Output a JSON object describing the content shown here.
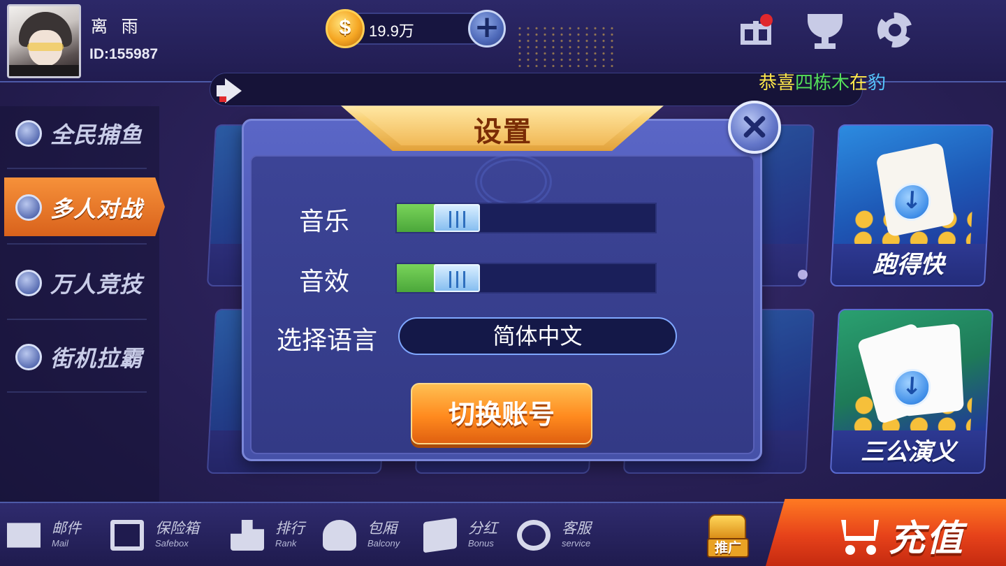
{
  "user": {
    "name": "离 雨",
    "id": "ID:155987"
  },
  "currency": {
    "amount": "19.9万",
    "symbol": "$"
  },
  "top_icons": [
    "gift-icon",
    "trophy-icon",
    "gear-icon"
  ],
  "marquee": {
    "part1": "恭喜",
    "part2": "四栋木",
    "part3": "在",
    "part4": "豹"
  },
  "sidebar": {
    "items": [
      {
        "label": "全民捕鱼",
        "active": false
      },
      {
        "label": "多人对战",
        "active": true
      },
      {
        "label": "万人竞技",
        "active": false
      },
      {
        "label": "街机拉霸",
        "active": false
      }
    ]
  },
  "games": {
    "right_top": "跑得快",
    "right_bottom": "三公演义"
  },
  "settings": {
    "title": "设置",
    "music_label": "音乐",
    "music_level": 0.16,
    "sfx_label": "音效",
    "sfx_level": 0.16,
    "language_label": "选择语言",
    "language_value": "简体中文",
    "switch_account": "切换账号"
  },
  "bottom": {
    "items": [
      {
        "cn": "邮件",
        "en": "Mail",
        "icon": "mail-icon"
      },
      {
        "cn": "保险箱",
        "en": "Safebox",
        "icon": "safebox-icon"
      },
      {
        "cn": "排行",
        "en": "Rank",
        "icon": "rank-icon"
      },
      {
        "cn": "包厢",
        "en": "Balcony",
        "icon": "balcony-icon"
      },
      {
        "cn": "分红",
        "en": "Bonus",
        "icon": "wallet-icon"
      },
      {
        "cn": "客服",
        "en": "service",
        "icon": "headset-icon"
      }
    ],
    "promo": "推广",
    "recharge": "充值"
  },
  "colors": {
    "accent": "#ff8a1e",
    "dialog": "#4651a8",
    "slider_fill": "#4ba73a"
  }
}
